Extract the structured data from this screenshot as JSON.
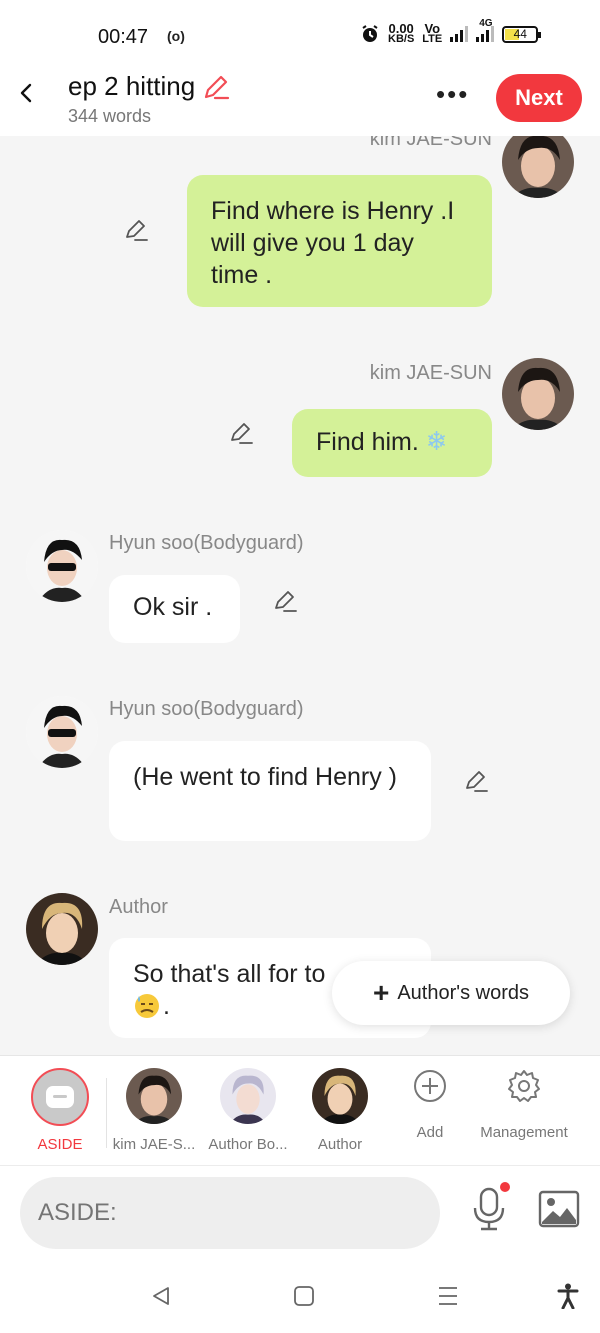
{
  "status_bar": {
    "time": "00:47",
    "hotspot": "(o)",
    "speed_value": "0.00",
    "speed_unit": "KB/S",
    "volte": "Vo",
    "lte": "LTE",
    "network": "4G",
    "battery": "44"
  },
  "header": {
    "title": "ep 2 hitting",
    "subtitle": "344 words",
    "more_label": "•••",
    "next_label": "Next"
  },
  "messages": [
    {
      "side": "right",
      "speaker": "kim JAE-SUN",
      "text": "Find where is Henry .I will give you 1 day time ."
    },
    {
      "side": "right",
      "speaker": "kim JAE-SUN",
      "text": "Find him."
    },
    {
      "side": "left",
      "speaker": "Hyun soo(Bodyguard)",
      "text": "Ok sir ."
    },
    {
      "side": "left",
      "speaker": "Hyun soo(Bodyguard)",
      "text": "(He went to find Henry )"
    },
    {
      "side": "left",
      "speaker": "Author",
      "text": "So that's all for to"
    }
  ],
  "floating_button": {
    "label": "Author's words",
    "icon": "plus-icon"
  },
  "roles": [
    {
      "label": "ASIDE",
      "active": true
    },
    {
      "label": "kim JAE-S..."
    },
    {
      "label": "Author Bo..."
    },
    {
      "label": "Author"
    },
    {
      "label": "Add"
    },
    {
      "label": "Management"
    }
  ],
  "input": {
    "placeholder": "ASIDE:"
  },
  "colors": {
    "accent": "#f2383e",
    "green_bubble": "#d4f198",
    "background": "#f5f5f5"
  }
}
